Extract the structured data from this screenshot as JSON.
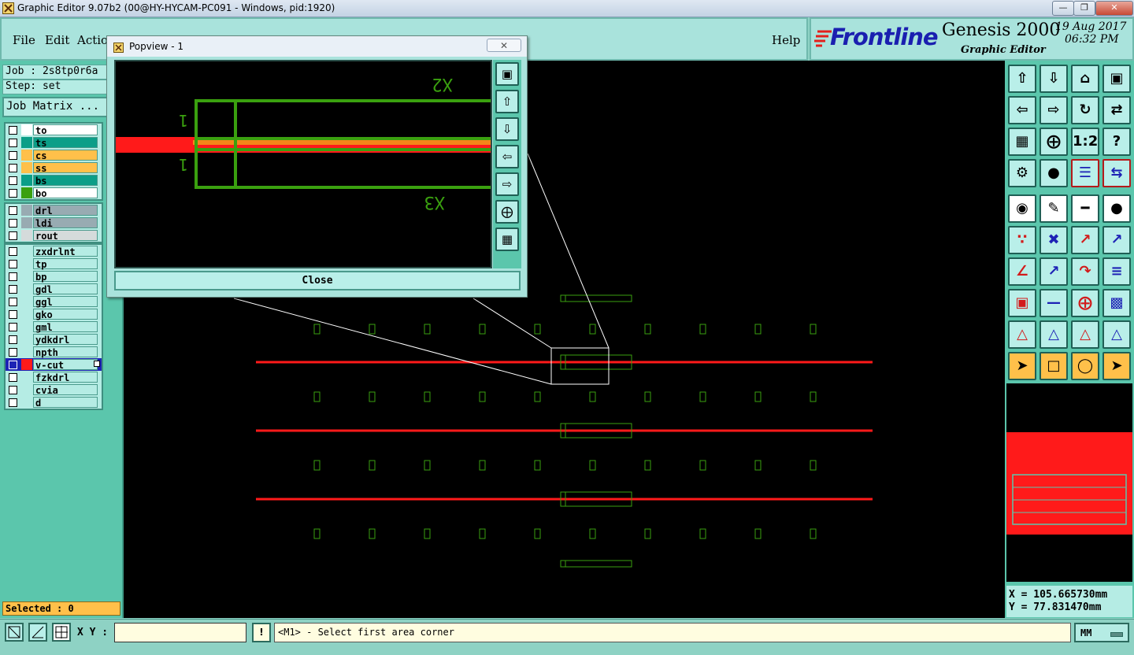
{
  "window": {
    "title": "Graphic Editor 9.07b2 (00@HY-HYCAM-PC091 - Windows, pid:1920)"
  },
  "menu": {
    "file": "File",
    "edit": "Edit",
    "action": "Action",
    "help": "Help"
  },
  "brand": {
    "logo": "Frontline",
    "product": "Genesis 2000",
    "subtitle": "Graphic Editor",
    "date": "19 Aug 2017",
    "time": "06:32 PM"
  },
  "job": {
    "job_label": "Job : 2s8tp0r6a",
    "step_label": "Step: set",
    "matrix_button": "Job Matrix ..."
  },
  "layers": {
    "group1": [
      {
        "name": "to",
        "color": "#ffffff",
        "row_color": "#ffffff"
      },
      {
        "name": "ts",
        "color": "#0b9e88",
        "row_color": "#0b9e88"
      },
      {
        "name": "cs",
        "color": "#ffc04a",
        "row_color": "#ffc04a"
      },
      {
        "name": "ss",
        "color": "#ffc04a",
        "row_color": "#ffc04a"
      },
      {
        "name": "bs",
        "color": "#0b9e88",
        "row_color": "#0b9e88"
      },
      {
        "name": "bo",
        "color": "#3aa00f",
        "row_color": "#ffffff"
      }
    ],
    "group2": [
      {
        "name": "drl",
        "color": "#98abb2",
        "row_color": "#98abb2"
      },
      {
        "name": "ldi",
        "color": "#98abb2",
        "row_color": "#98abb2"
      },
      {
        "name": "rout",
        "color": "#d5dbdb",
        "row_color": "#d5dbdb"
      }
    ],
    "group3": [
      {
        "name": "zxdrlnt"
      },
      {
        "name": "tp"
      },
      {
        "name": "bp"
      },
      {
        "name": "gdl"
      },
      {
        "name": "ggl"
      },
      {
        "name": "gko"
      },
      {
        "name": "gml"
      },
      {
        "name": "ydkdrl"
      },
      {
        "name": "npth"
      },
      {
        "name": "v-cut",
        "active": true
      },
      {
        "name": "fzkdrl"
      },
      {
        "name": "cvia"
      },
      {
        "name": "d"
      }
    ]
  },
  "popview": {
    "title": "Popview - 1",
    "close_button": "Close",
    "label_x2": "X2",
    "label_x3": "X3",
    "label_1a": "1",
    "label_1b": "1"
  },
  "status": {
    "selected": "Selected : 0",
    "xy_label": "X Y :",
    "xy_value": "",
    "prompt": "<M1> - Select first area corner",
    "units": "MM"
  },
  "coords": {
    "x": "X = 105.665730mm",
    "y": "Y = 77.831470mm"
  },
  "colors": {
    "panel": "#5bc6ac",
    "canvas": "#000000",
    "vcut": "#ff1a1a",
    "outline": "#3aa00f",
    "accent": "#ffc04a"
  }
}
